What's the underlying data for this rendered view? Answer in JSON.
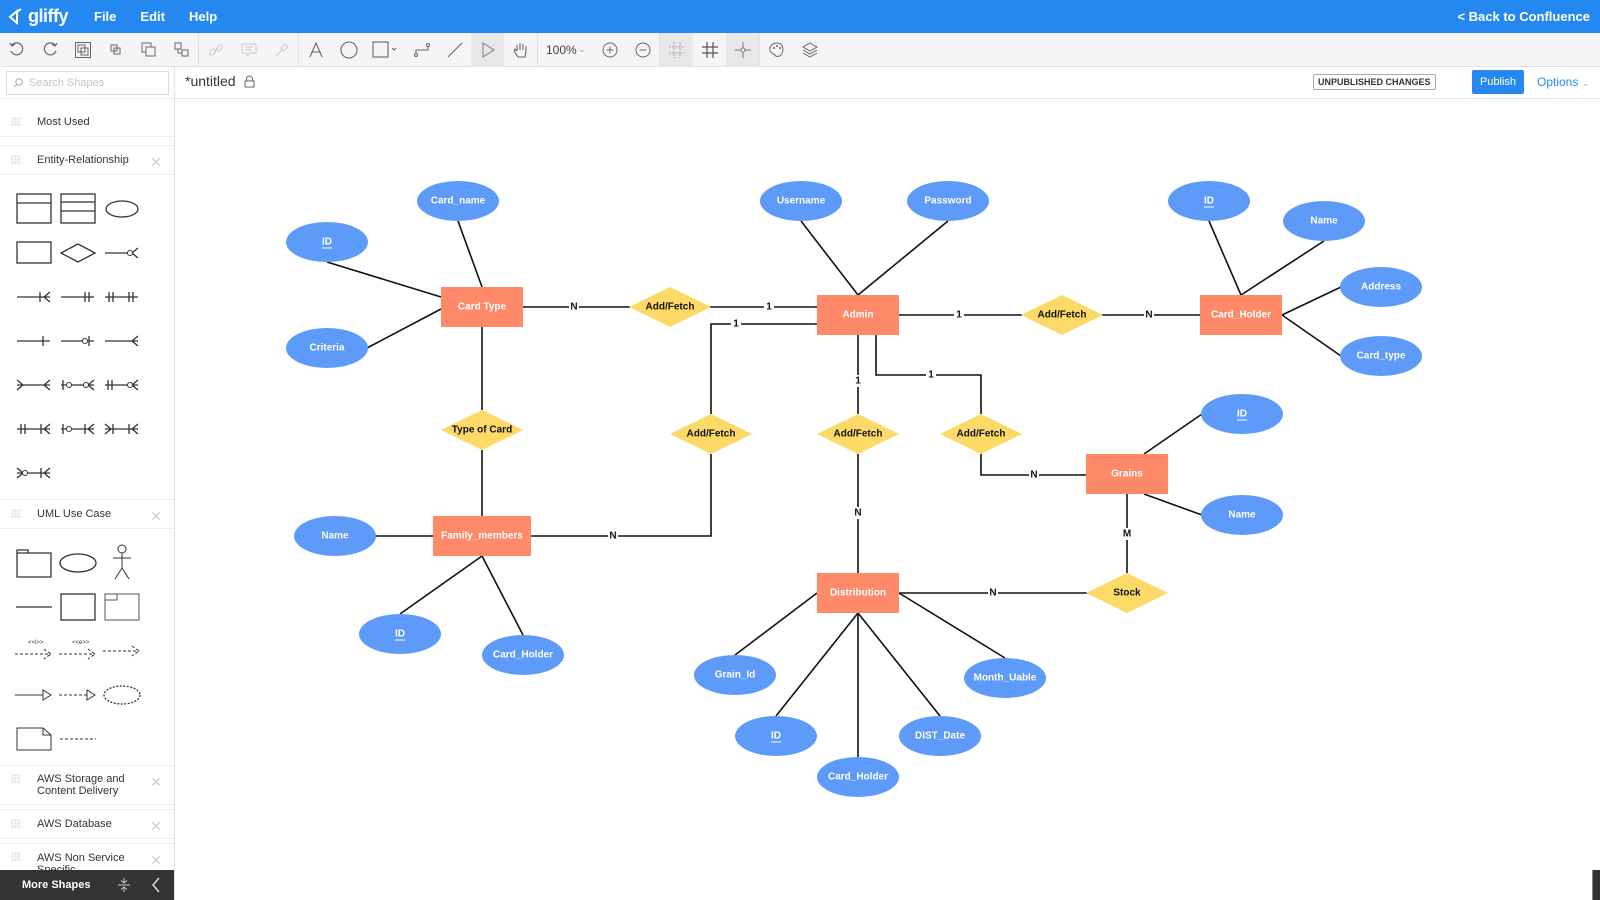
{
  "app": {
    "logo_text": "gliffy",
    "menu": [
      "File",
      "Edit",
      "Help"
    ],
    "back_link": "< Back to Confluence"
  },
  "toolbar": {
    "zoom_level": "100%",
    "buttons": [
      "undo-icon",
      "redo-icon",
      "group-icon",
      "ungroup-icon",
      "bring-front-icon",
      "send-back-icon",
      "link-icon",
      "comment-icon",
      "eyedropper-icon",
      "text-tool-icon",
      "ellipse-tool-icon",
      "rectangle-tool-icon",
      "connector-tool-icon",
      "line-tool-icon",
      "pointer-tool-icon",
      "pan-tool-icon",
      "zoom-in-icon",
      "zoom-out-icon",
      "grid-off-icon",
      "grid-icon",
      "snap-icon",
      "theme-icon",
      "layers-icon"
    ]
  },
  "sidebar": {
    "search_placeholder": "Search Shapes",
    "sections": [
      {
        "title": "Most Used",
        "closable": false
      },
      {
        "title": "Entity-Relationship",
        "closable": true
      },
      {
        "title": "UML Use Case",
        "closable": true
      },
      {
        "title": "AWS Storage and Content Delivery",
        "closable": true
      },
      {
        "title": "AWS Database",
        "closable": true
      },
      {
        "title": "AWS Non Service Specific",
        "closable": true
      }
    ],
    "uml_labels": {
      "include": "<<i>>",
      "extend": "<<e>>"
    },
    "more_shapes": "More Shapes"
  },
  "document": {
    "title": "*untitled",
    "status_badge": "UNPUBLISHED CHANGES",
    "publish_label": "Publish",
    "options_label": "Options"
  },
  "colors": {
    "brand": "#2588f0",
    "entity": "#fe8a6a",
    "attribute": "#5e9af8",
    "relationship": "#fdd967"
  },
  "diagram": {
    "entities": [
      {
        "id": "card_type",
        "label": "Card Type"
      },
      {
        "id": "admin",
        "label": "Admin"
      },
      {
        "id": "card_holder",
        "label": "Card_Holder"
      },
      {
        "id": "family_members",
        "label": "Family_members"
      },
      {
        "id": "grains",
        "label": "Grains"
      },
      {
        "id": "distribution",
        "label": "Distribution"
      }
    ],
    "relationships": [
      {
        "id": "r_ct_admin",
        "label": "Add/Fetch"
      },
      {
        "id": "r_admin_ch",
        "label": "Add/Fetch"
      },
      {
        "id": "r_type_of_card",
        "label": "Type of Card"
      },
      {
        "id": "r_admin_fm",
        "label": "Add/Fetch"
      },
      {
        "id": "r_admin_dist",
        "label": "Add/Fetch"
      },
      {
        "id": "r_admin_grains",
        "label": "Add/Fetch"
      },
      {
        "id": "r_stock",
        "label": "Stock"
      }
    ],
    "attributes": [
      {
        "id": "ct_id",
        "label": "ID",
        "key": true
      },
      {
        "id": "ct_card_name",
        "label": "Card_name",
        "key": false
      },
      {
        "id": "ct_criteria",
        "label": "Criteria",
        "key": false
      },
      {
        "id": "ad_username",
        "label": "Username",
        "key": false
      },
      {
        "id": "ad_password",
        "label": "Password",
        "key": false
      },
      {
        "id": "ch_id",
        "label": "ID",
        "key": true
      },
      {
        "id": "ch_name",
        "label": "Name",
        "key": false
      },
      {
        "id": "ch_address",
        "label": "Address",
        "key": false
      },
      {
        "id": "ch_card_type",
        "label": "Card_type",
        "key": false
      },
      {
        "id": "gr_id",
        "label": "ID",
        "key": true
      },
      {
        "id": "gr_name",
        "label": "Name",
        "key": false
      },
      {
        "id": "fm_name",
        "label": "Name",
        "key": false
      },
      {
        "id": "fm_id",
        "label": "ID",
        "key": true
      },
      {
        "id": "fm_card_holder",
        "label": "Card_Holder",
        "key": false
      },
      {
        "id": "di_grain_id",
        "label": "Grain_Id",
        "key": false
      },
      {
        "id": "di_id",
        "label": "ID",
        "key": true
      },
      {
        "id": "di_card_holder",
        "label": "Card_Holder",
        "key": false
      },
      {
        "id": "di_dist_date",
        "label": "DIST_Date",
        "key": false
      },
      {
        "id": "di_month_uable",
        "label": "Month_Uable",
        "key": false
      }
    ],
    "cardinalities": [
      {
        "id": "c1",
        "label": "N"
      },
      {
        "id": "c2",
        "label": "1"
      },
      {
        "id": "c3",
        "label": "1"
      },
      {
        "id": "c4",
        "label": "1"
      },
      {
        "id": "c5",
        "label": "N"
      },
      {
        "id": "c6",
        "label": "1"
      },
      {
        "id": "c7",
        "label": "1"
      },
      {
        "id": "c8",
        "label": "N"
      },
      {
        "id": "c9",
        "label": "N"
      },
      {
        "id": "c10",
        "label": "N"
      },
      {
        "id": "c11",
        "label": "M"
      },
      {
        "id": "c12",
        "label": "N"
      }
    ]
  }
}
